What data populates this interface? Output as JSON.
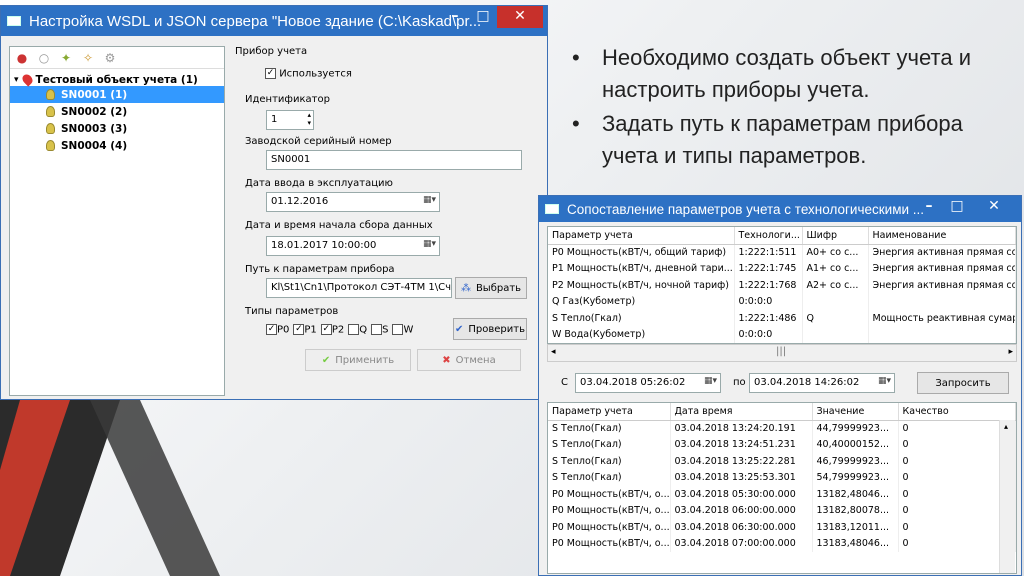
{
  "bullets": [
    "Необходимо создать объект учета и настроить приборы учета.",
    "Задать путь к параметрам прибора учета и типы параметров."
  ],
  "main_window": {
    "title": "Настройка WSDL и  JSON сервера \"Новое здание (C:\\Kaskad\\pr...",
    "tree": {
      "root": "Тестовый объект учета (1)",
      "items": [
        "SN0001 (1)",
        "SN0002 (2)",
        "SN0003 (3)",
        "SN0004 (4)"
      ],
      "selected_index": 0
    },
    "form": {
      "group_title": "Прибор учета",
      "used_label": "Используется",
      "used_checked": true,
      "id_label": "Идентификатор",
      "id_value": "1",
      "serial_label": "Заводской серийный номер",
      "serial_value": "SN0001",
      "commission_label": "Дата ввода в эксплуатацию",
      "commission_value": "01.12.2016",
      "start_label": "Дата и время начала сбора данных",
      "start_value": "18.01.2017 10:00:00",
      "path_label": "Путь к параметрам прибора",
      "path_value": "Kl\\St1\\Cn1\\Протокол СЭТ-4ТМ 1\\Счетч",
      "select_button": "Выбрать",
      "types_label": "Типы параметров",
      "types": [
        {
          "label": "P0",
          "checked": true
        },
        {
          "label": "P1",
          "checked": true
        },
        {
          "label": "P2",
          "checked": true
        },
        {
          "label": "Q",
          "checked": false
        },
        {
          "label": "S",
          "checked": false
        },
        {
          "label": "W",
          "checked": false
        }
      ],
      "check_button": "Проверить",
      "apply_button": "Применить",
      "cancel_button": "Отмена"
    }
  },
  "map_window": {
    "title": "Сопоставление параметров учета с технологическими ...",
    "top_grid": {
      "columns": [
        "Параметр учета",
        "Технологи...",
        "Шифр",
        "Наименование"
      ],
      "rows": [
        [
          "P0 Мощность(кВТ/ч, общий тариф)",
          "1:222:1:511",
          "A0+ со с...",
          "Энергия активная прямая со..."
        ],
        [
          "P1 Мощность(кВТ/ч, дневной тари...",
          "1:222:1:745",
          "A1+ со с...",
          "Энергия активная прямая со..."
        ],
        [
          "P2 Мощность(кВТ/ч, ночной тариф)",
          "1:222:1:768",
          "A2+ со с...",
          "Энергия активная прямая со..."
        ],
        [
          "Q Газ(Кубометр)",
          "0:0:0:0",
          "",
          ""
        ],
        [
          "S Тепло(Гкал)",
          "1:222:1:486",
          "Q",
          "Мощность реактивная сумар..."
        ],
        [
          "W Вода(Кубометр)",
          "0:0:0:0",
          "",
          ""
        ]
      ]
    },
    "from_label": "С",
    "from_value": "03.04.2018 05:26:02",
    "to_label": "по",
    "to_value": "03.04.2018 14:26:02",
    "request_button": "Запросить",
    "bottom_grid": {
      "columns": [
        "Параметр учета",
        "Дата время",
        "Значение",
        "Качество"
      ],
      "rows": [
        [
          "S Тепло(Гкал)",
          "03.04.2018 13:24:20.191",
          "44,79999923...",
          "0"
        ],
        [
          "S Тепло(Гкал)",
          "03.04.2018 13:24:51.231",
          "40,40000152...",
          "0"
        ],
        [
          "S Тепло(Гкал)",
          "03.04.2018 13:25:22.281",
          "46,79999923...",
          "0"
        ],
        [
          "S Тепло(Гкал)",
          "03.04.2018 13:25:53.301",
          "54,79999923...",
          "0"
        ],
        [
          "P0 Мощность(кВТ/ч, о...",
          "03.04.2018 05:30:00.000",
          "13182,48046...",
          "0"
        ],
        [
          "P0 Мощность(кВТ/ч, о...",
          "03.04.2018 06:00:00.000",
          "13182,80078...",
          "0"
        ],
        [
          "P0 Мощность(кВТ/ч, о...",
          "03.04.2018 06:30:00.000",
          "13183,12011...",
          "0"
        ],
        [
          "P0 Мощность(кВТ/ч, о...",
          "03.04.2018 07:00:00.000",
          "13183,48046...",
          "0"
        ]
      ]
    }
  }
}
